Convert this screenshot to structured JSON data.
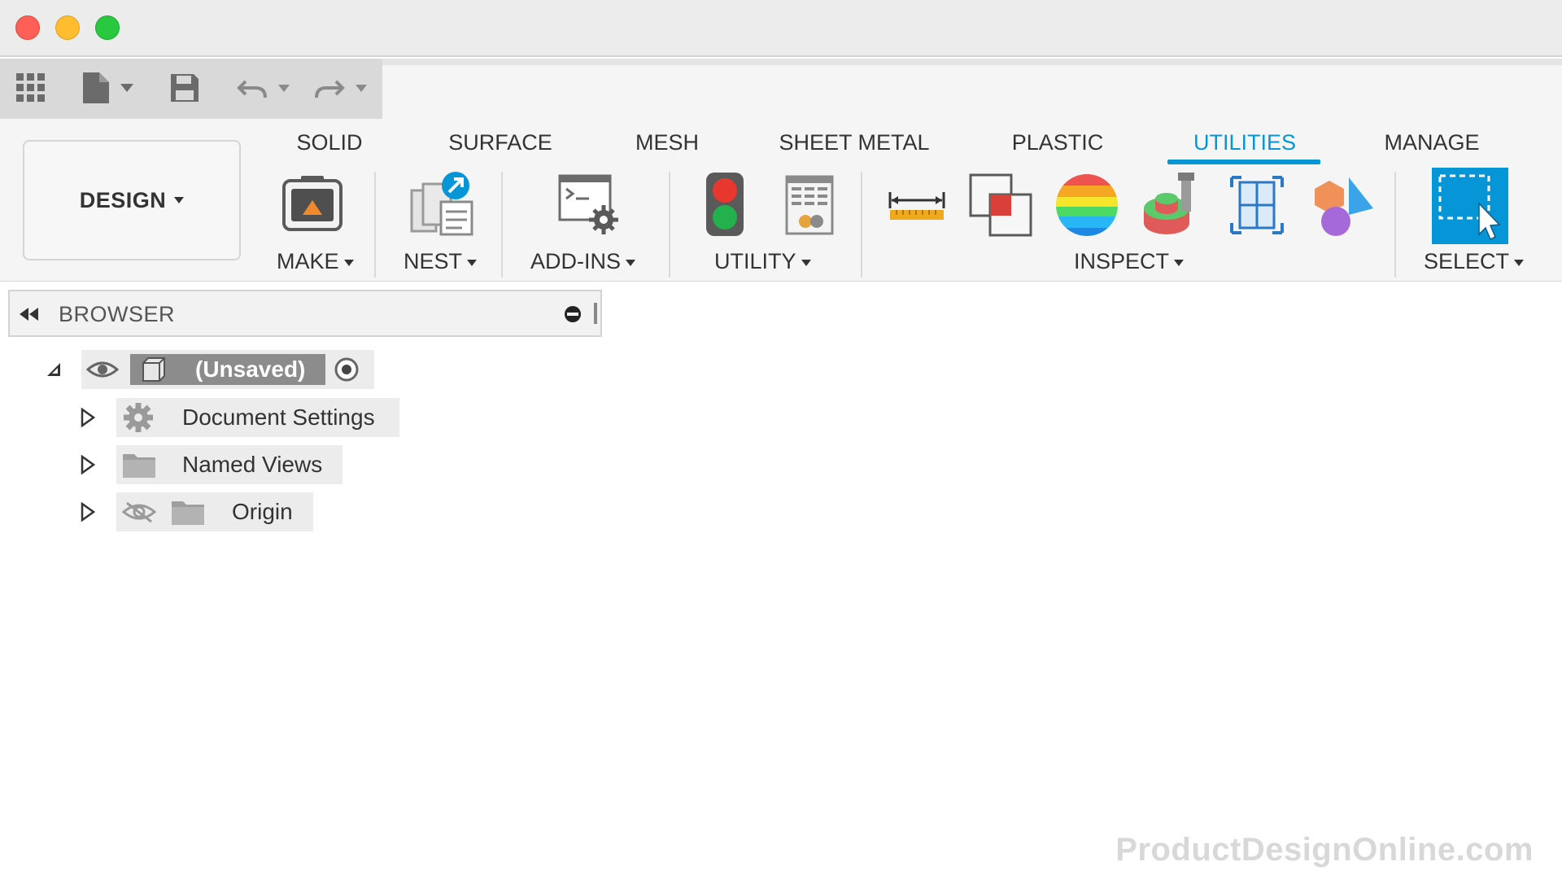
{
  "window": {
    "controls": [
      "close",
      "minimize",
      "zoom"
    ]
  },
  "quick_access": {
    "icons": [
      "app-grid-icon",
      "file-icon",
      "save-icon",
      "undo-icon",
      "redo-icon"
    ]
  },
  "workspace": {
    "label": "DESIGN"
  },
  "tabs": [
    {
      "label": "SOLID"
    },
    {
      "label": "SURFACE"
    },
    {
      "label": "MESH"
    },
    {
      "label": "SHEET METAL"
    },
    {
      "label": "PLASTIC"
    },
    {
      "label": "UTILITIES"
    },
    {
      "label": "MANAGE"
    }
  ],
  "active_tab": "UTILITIES",
  "groups": {
    "make": "MAKE",
    "nest": "NEST",
    "addins": "ADD-INS",
    "utility": "UTILITY",
    "inspect": "INSPECT",
    "select": "SELECT"
  },
  "colors": {
    "accent": "#0696d7",
    "close": "#fe5f57",
    "minimize": "#febc2e",
    "zoom": "#28c840"
  },
  "browser": {
    "title": "BROWSER",
    "root": {
      "label": "(Unsaved)"
    },
    "items": [
      {
        "label": "Document Settings"
      },
      {
        "label": "Named Views"
      },
      {
        "label": "Origin"
      }
    ]
  },
  "watermark": "ProductDesignOnline.com"
}
